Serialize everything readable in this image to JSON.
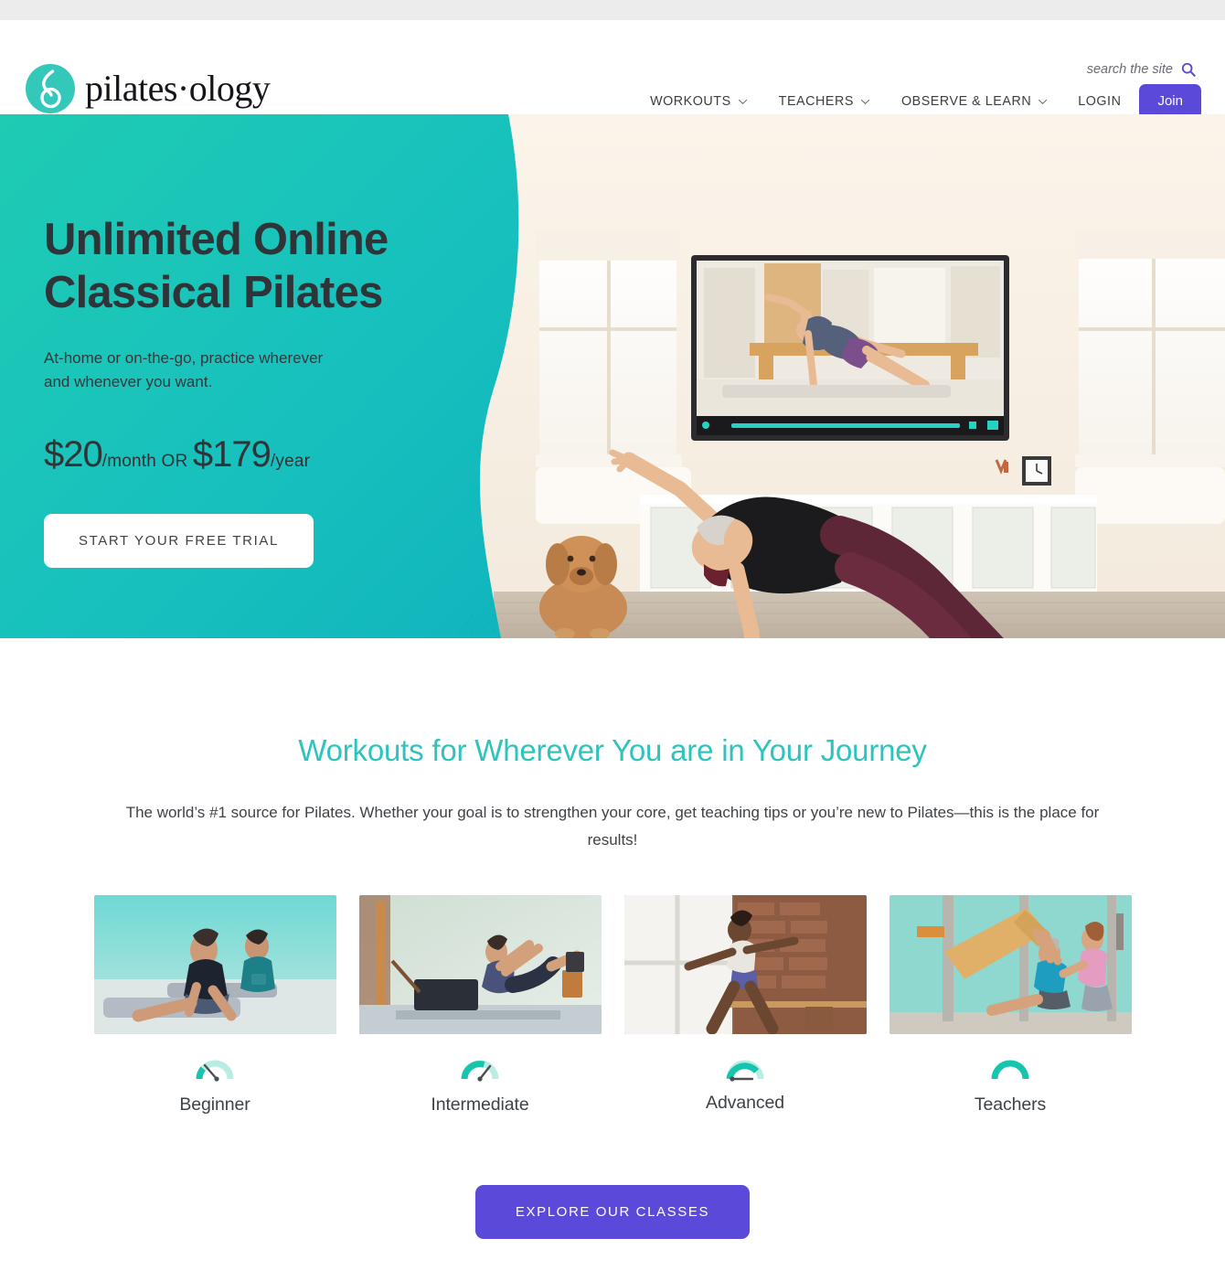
{
  "header": {
    "logo_text": "pilates·ology",
    "logo_icon": "pilatesology-mark-icon",
    "search": {
      "placeholder": "search the site",
      "value": "",
      "icon": "search-icon"
    },
    "nav": [
      {
        "label": "WORKOUTS",
        "has_dropdown": true,
        "icon": "chevron-down-icon"
      },
      {
        "label": "TEACHERS",
        "has_dropdown": true,
        "icon": "chevron-down-icon"
      },
      {
        "label": "OBSERVE & LEARN",
        "has_dropdown": true,
        "icon": "chevron-down-icon"
      }
    ],
    "login_label": "LOGIN",
    "join_label": "Join"
  },
  "hero": {
    "title_line1": "Unlimited Online",
    "title_line2": "Classical Pilates",
    "subtitle": "At-home or on-the-go, practice wherever and whenever you want.",
    "price_monthly_amount": "$20",
    "price_monthly_unit": "/month",
    "price_separator": " OR ",
    "price_yearly_amount": "$179",
    "price_yearly_unit": "/year",
    "cta_label": "START YOUR FREE TRIAL",
    "image_alt": "Woman doing a side plank on a green mat in a living room with a golden doodle dog and a wall TV showing a Pilates class"
  },
  "journey": {
    "title": "Workouts for Wherever You are in Your Journey",
    "description": "The world’s #1 source for Pilates. Whether your goal is to strengthen your core, get teaching tips or you’re new to Pilates—this is the place for results!",
    "cards": [
      {
        "label": "Beginner",
        "icon": "gauge-beginner-icon",
        "image_alt": "Two women in swan pose on mats"
      },
      {
        "label": "Intermediate",
        "icon": "gauge-intermediate-icon",
        "image_alt": "Woman on a reformer with legs extended"
      },
      {
        "label": "Advanced",
        "icon": "gauge-advanced-icon",
        "image_alt": "Woman at the ballet barre in a brick studio"
      },
      {
        "label": "Teachers",
        "icon": "gauge-teachers-icon",
        "image_alt": "Teacher assisting a student on a Cadillac"
      }
    ],
    "explore_label": "EXPLORE OUR CLASSES"
  },
  "colors": {
    "teal": "#1abfbd",
    "teal_light": "#1ccab4",
    "heading_teal": "#2ec4bc",
    "purple": "#5b4ad9",
    "text_dark": "#3e4246",
    "topbar_grey": "#ececec"
  }
}
